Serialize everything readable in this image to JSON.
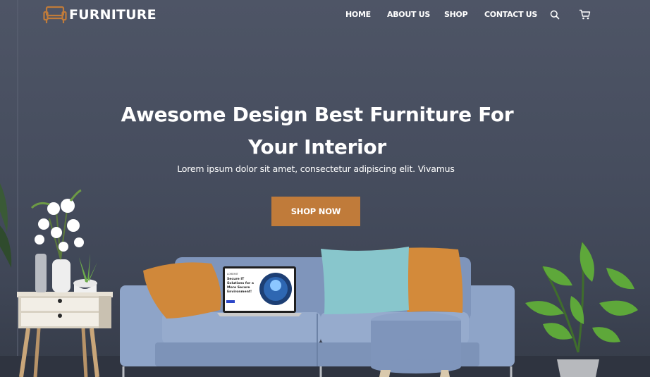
{
  "brand": {
    "name": "FURNITURE",
    "logo_icon": "sofa-icon",
    "accent_color": "#c07b3a"
  },
  "nav": {
    "items": [
      {
        "label": "HOME"
      },
      {
        "label": "ABOUT US"
      },
      {
        "label": "SHOP"
      },
      {
        "label": "CONTACT US"
      }
    ],
    "search_icon": "search-icon",
    "cart_icon": "cart-icon"
  },
  "hero": {
    "title_line1": "Awesome Design Best Furniture For",
    "title_line2": "Your Interior",
    "subtitle": "Lorem ipsum dolor sit amet, consectetur adipiscing elit. Vivamus",
    "cta_label": "SHOP NOW",
    "wall_color": "#4a5162"
  },
  "laptop": {
    "screen_brand": "LOREMIT",
    "screen_heading_1": "Secure IT",
    "screen_heading_2": "Solutions for a",
    "screen_heading_3": "More Secure",
    "screen_heading_4": "Environment!"
  }
}
